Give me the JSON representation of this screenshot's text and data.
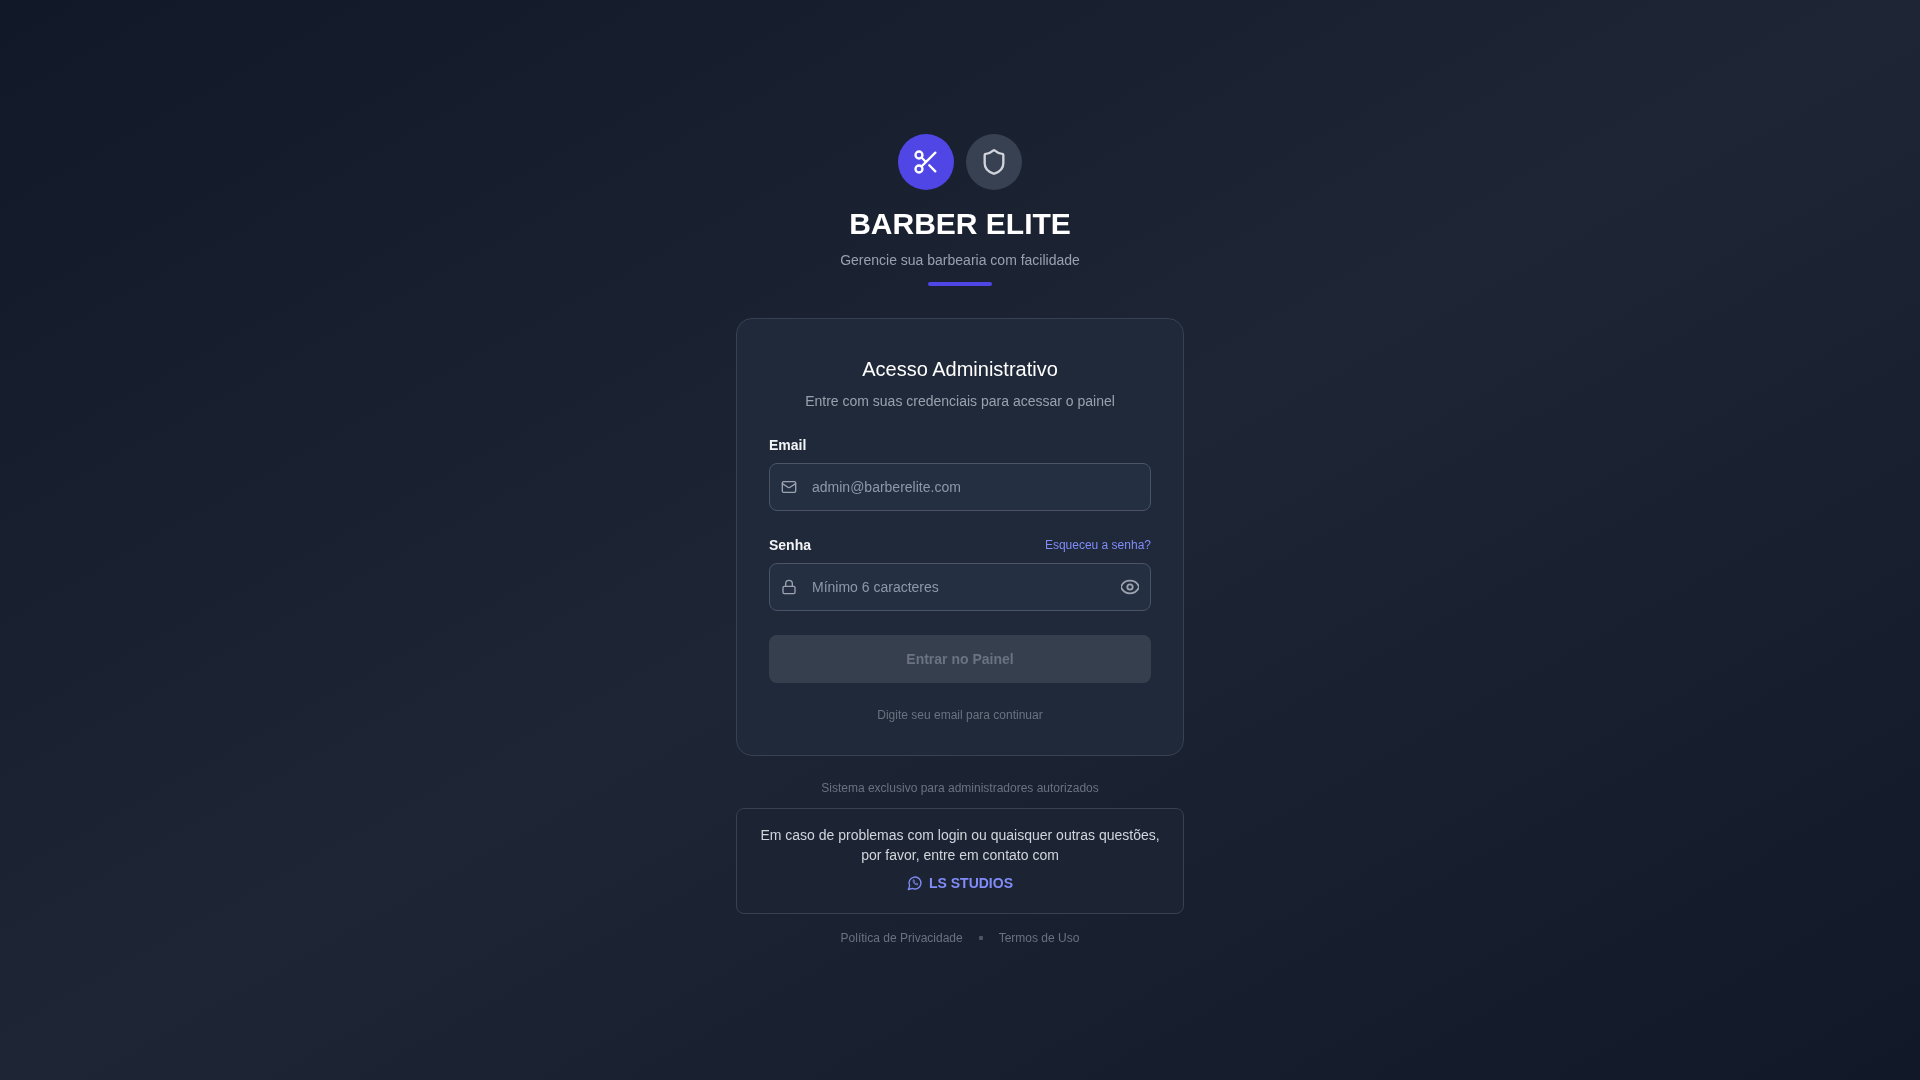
{
  "brand": {
    "title": "BARBER ELITE",
    "subtitle": "Gerencie sua barbearia com facilidade"
  },
  "login_card": {
    "title": "Acesso Administrativo",
    "subtitle": "Entre com suas credenciais para acessar o painel",
    "fields": [
      {
        "kind": "email",
        "label": "Email",
        "placeholder": "admin@barberelite.com"
      },
      {
        "kind": "password",
        "label": "Senha",
        "link": "Esqueceu a senha?",
        "placeholder": "Mínimo 6 caracteres"
      }
    ],
    "submit": {
      "label": "Entrar no Painel",
      "disabled": true
    },
    "hint": "Digite seu email para continuar"
  },
  "notice": "Sistema exclusivo para administradores autorizados",
  "contact": {
    "text": "Em caso de problemas com login ou quaisquer outras questões, por favor, entre em contato com",
    "link": "LS STUDIOS"
  },
  "footer_links": [
    "Política de Privacidade",
    "Termos de Uso"
  ]
}
